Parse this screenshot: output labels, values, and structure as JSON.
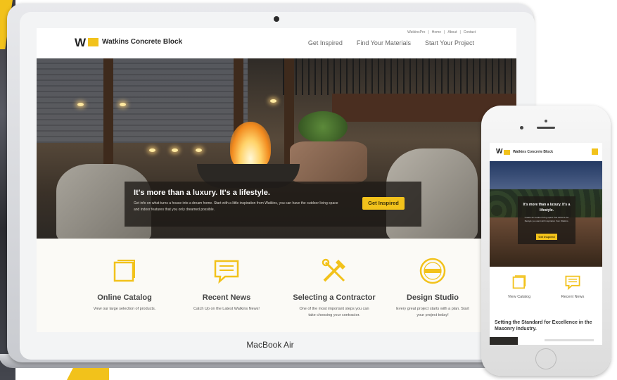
{
  "desktop": {
    "device_label": "MacBook Air",
    "header": {
      "logo_mark": "W",
      "brand": "Watkins Concrete Block",
      "utility_links": [
        "WatkinsPro",
        "Home",
        "About",
        "Contact"
      ],
      "nav": [
        "Get Inspired",
        "Find Your Materials",
        "Start Your Project"
      ]
    },
    "hero": {
      "headline": "It's more than a luxury. It's a lifestyle.",
      "body": "Get info on what turns a house into a dream home. Start with a little inspiration from Watkins, you can have the outdoor living space and indoor features that you only dreamed possible.",
      "cta": "Get Inspired"
    },
    "features": [
      {
        "title": "Online Catalog",
        "desc": "View our large selection of products."
      },
      {
        "title": "Recent News",
        "desc": "Catch Up on the Latest Watkins News!"
      },
      {
        "title": "Selecting a Contractor",
        "desc": "One of the most important steps you can take choosing your contractor."
      },
      {
        "title": "Design Studio",
        "desc": "Every great project starts with a plan. Start your project today!"
      }
    ]
  },
  "mobile": {
    "header": {
      "logo_mark": "W",
      "brand": "Watkins Concrete Block"
    },
    "hero": {
      "headline": "It's more than a luxury. It's a lifestyle.",
      "body": "Create an outdoor living space that delivers the lifestyle you want with inspiration from Watkins.",
      "cta": "Get Inspired"
    },
    "features": [
      {
        "title": "View Catalog"
      },
      {
        "title": "Recent News"
      }
    ],
    "section_title": "Setting the Standard for Excellence in the Masonry Industry."
  },
  "colors": {
    "accent": "#f2c21b",
    "text_dark": "#2a2a2a",
    "overlay": "#1e1a16"
  },
  "icons": [
    "catalog-icon",
    "news-icon",
    "tools-icon",
    "design-studio-badge-icon"
  ]
}
